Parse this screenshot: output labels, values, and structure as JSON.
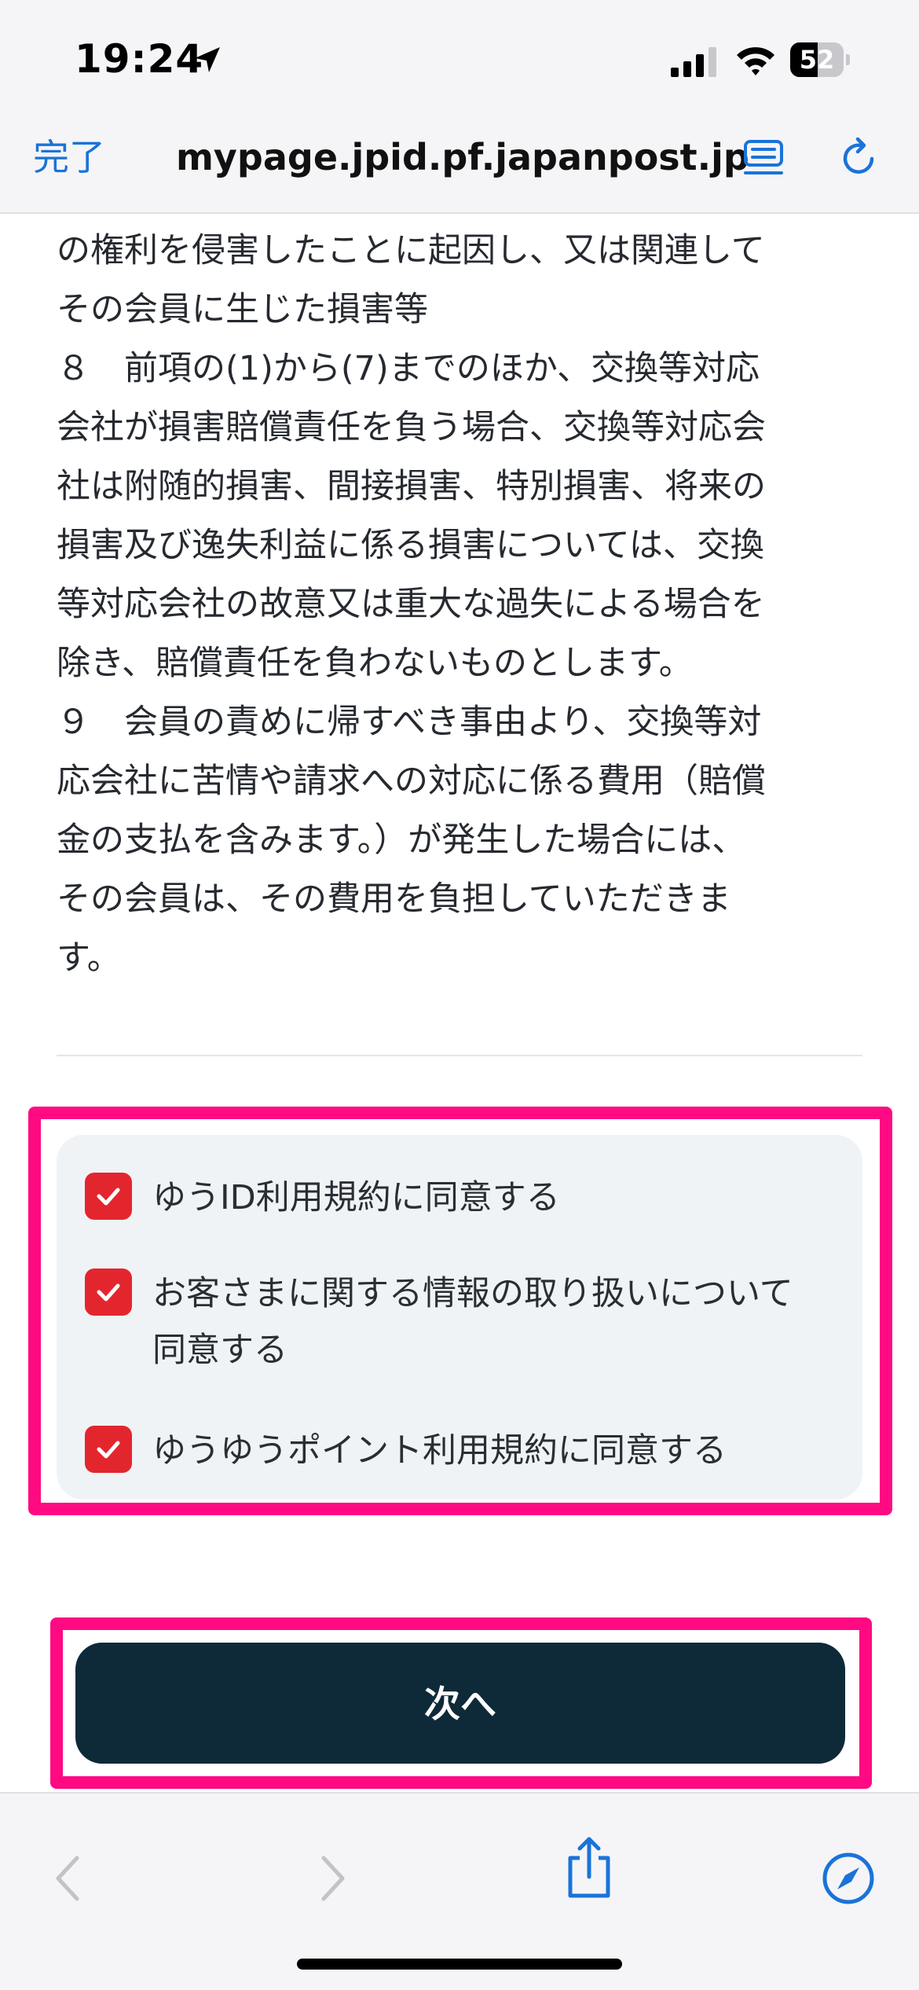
{
  "status_bar": {
    "time": "19:24",
    "battery_level": "52",
    "battery_fraction": 0.52
  },
  "browser": {
    "done_label": "完了",
    "url": "mypage.jpid.pf.japanpost.jp"
  },
  "terms": {
    "text": "の権利を侵害したことに起因し、又は関連して\nその会員に生じた損害等\n８　前項の(1)から(7)までのほか、交換等対応\n会社が損害賠償責任を負う場合、交換等対応会\n社は附随的損害、間接損害、特別損害、将来の\n損害及び逸失利益に係る損害については、交換\n等対応会社の故意又は重大な過失による場合を\n除き、賠償責任を負わないものとします。\n９　会員の責めに帰すべき事由より、交換等対\n応会社に苦情や請求への対応に係る費用（賠償\n金の支払を含みます。）が発生した場合には、\nその会員は、その費用を負担していただきま\nす。"
  },
  "consents": [
    {
      "label": "ゆうID利用規約に同意する",
      "checked": true
    },
    {
      "label": "お客さまに関する情報の取り扱いについて同意する",
      "checked": true
    },
    {
      "label": "ゆうゆうポイント利用規約に同意する",
      "checked": true
    }
  ],
  "next_button": {
    "label": "次へ"
  },
  "colors": {
    "accent_blue": "#1a73d9",
    "checkbox_red": "#e3262e",
    "highlight_pink": "#ff0a82",
    "button_navy": "#0e2a38",
    "consent_bg": "#f0f3f6"
  },
  "icons": {
    "location": "location-arrow-icon",
    "signal": "cellular-signal-icon",
    "wifi": "wifi-icon",
    "reader": "reader-mode-icon",
    "reload": "reload-icon",
    "back": "chevron-left-icon",
    "forward": "chevron-right-icon",
    "share": "share-icon",
    "safari": "compass-icon"
  }
}
